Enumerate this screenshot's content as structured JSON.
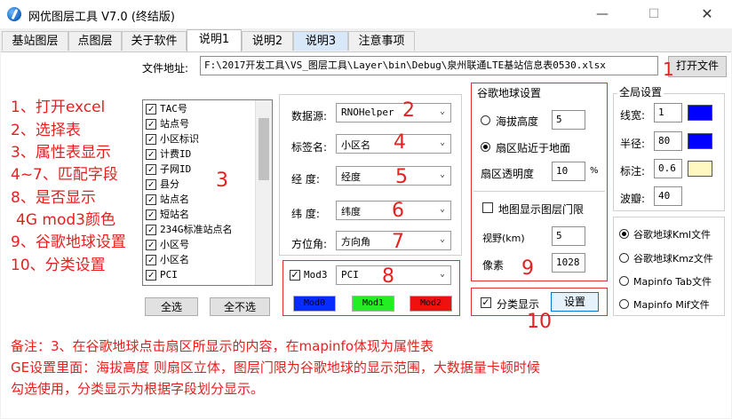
{
  "window": {
    "title": "网优图层工具 V7.0 (终结版)",
    "min": "—",
    "max": "☐",
    "close": "✕"
  },
  "tabs": [
    "基站图层",
    "点图层",
    "关于软件",
    "说明1",
    "说明2",
    "说明3",
    "注意事项"
  ],
  "file": {
    "label": "文件地址:",
    "path": "F:\\2017开发工具\\VS_图层工具\\Layer\\bin\\Debug\\泉州联通LTE基站信息表0530.xlsx",
    "open_button": "打开文件"
  },
  "field_list": {
    "items": [
      "TAC号",
      "站点号",
      "小区标识",
      "计费ID",
      "子网ID",
      "县分",
      "站点名",
      "短站名",
      "234G标准站点名",
      "小区号",
      "小区名",
      "PCI"
    ],
    "select_all": "全选",
    "deselect_all": "全不选"
  },
  "mapping": {
    "datasource": {
      "label": "数据源:",
      "value": "RNOHelper"
    },
    "tag_name": {
      "label": "标签名:",
      "value": "小区名"
    },
    "longitude": {
      "label": "经 度:",
      "value": "经度"
    },
    "latitude": {
      "label": "纬 度:",
      "value": "纬度"
    },
    "azimuth": {
      "label": "方位角:",
      "value": "方向角"
    },
    "mod3": {
      "label": "Mod3",
      "value": "PCI",
      "checked": true,
      "swatches": [
        {
          "label": "Mod0",
          "color": "#0a2bff"
        },
        {
          "label": "Mod1",
          "color": "#22ee22"
        },
        {
          "label": "Mod2",
          "color": "#ee1111"
        }
      ]
    }
  },
  "google_earth": {
    "title": "谷歌地球设置",
    "altitude_label": "海拔高度",
    "altitude_value": "5",
    "ground_label": "扇区贴近于地面",
    "transparency_label": "扇区透明度",
    "transparency_value": "10",
    "transparency_unit": "%",
    "threshold_label": "地图显示图层门限",
    "view_label": "视野(km)",
    "view_value": "5",
    "pixel_label": "像素",
    "pixel_value": "1028"
  },
  "global": {
    "title": "全局设置",
    "line_width_label": "线宽:",
    "line_width_value": "1",
    "radius_label": "半径:",
    "radius_value": "80",
    "label_label": "标注:",
    "label_value": "0.6",
    "lobe_label": "波瓣:",
    "lobe_value": "40",
    "colors": {
      "line": "#0000ff",
      "radius": "#0000ff",
      "label": "#fff8c0"
    }
  },
  "classify": {
    "label": "分类显示",
    "button": "设置",
    "checked": true
  },
  "export": [
    "谷歌地球Kml文件",
    "谷歌地球Kmz文件",
    "Mapinfo Tab文件",
    "Mapinfo Mif文件"
  ],
  "annotations": {
    "steps": [
      "1、打开excel",
      "2、选择表",
      "3、属性表显示",
      "4~7、匹配字段",
      "8、是否显示",
      "4G mod3颜色",
      "9、谷歌地球设置",
      "10、分类设置"
    ],
    "markers": [
      "1",
      "2",
      "3",
      "4",
      "5",
      "6",
      "7",
      "8",
      "9",
      "10"
    ],
    "notes": [
      "备注：3、在谷歌地球点击扇区所显示的内容，在mapinfo体现为属性表",
      "GE设置里面：海拔高度 则扇区立体，图层门限为谷歌地球的显示范围，大数据量卡顿时候",
      "勾选使用，分类显示为根据字段划分显示。"
    ]
  }
}
